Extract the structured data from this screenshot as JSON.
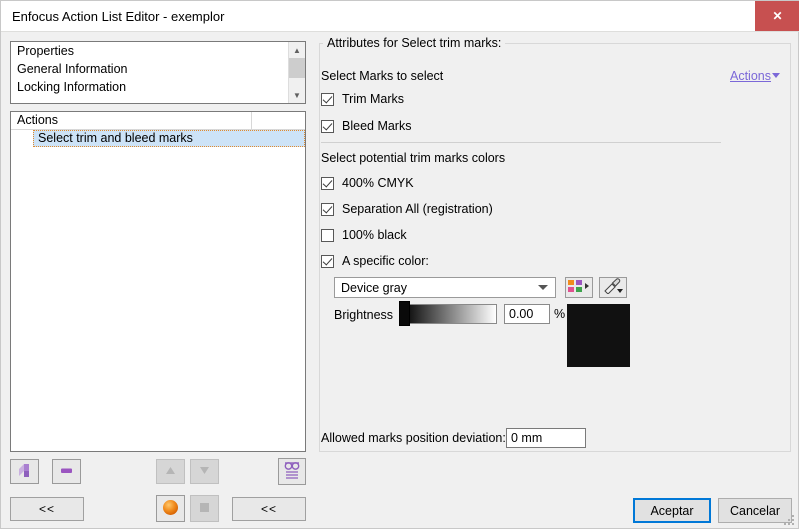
{
  "window": {
    "title": "Enfocus Action List Editor - exemplor",
    "close_label": "✕"
  },
  "properties_list": {
    "items": [
      {
        "label": "Properties"
      },
      {
        "label": "General Information"
      },
      {
        "label": "Locking Information"
      }
    ]
  },
  "actions_list": {
    "header": "Actions",
    "rows": [
      {
        "label": "Select trim and bleed marks",
        "selected": true
      }
    ]
  },
  "left_toolbar": {
    "add_action_icon": "add-action-icon",
    "remove_action_icon": "remove-action-icon",
    "move_up_icon": "move-up-icon",
    "move_down_icon": "move-down-icon",
    "preview_icon": "glasses-preview-icon",
    "collapse_left_label": "<<",
    "enabled_icon": "orange-sphere-icon",
    "disabled_icon": "gray-square-icon",
    "collapse_mid_label": "<<"
  },
  "attributes": {
    "group_title": "Attributes for Select trim marks:",
    "marks_section_label": "Select Marks to select",
    "actions_link": "Actions",
    "marks_checkboxes": [
      {
        "label": "Trim Marks",
        "checked": true
      },
      {
        "label": "Bleed Marks",
        "checked": true
      }
    ],
    "colors_section_label": "Select potential trim marks colors",
    "color_checkboxes": [
      {
        "label": "400% CMYK",
        "checked": true
      },
      {
        "label": "Separation All (registration)",
        "checked": true
      },
      {
        "label": "100% black",
        "checked": false
      },
      {
        "label": "A specific color:",
        "checked": true
      }
    ],
    "colorspace_combo": {
      "value": "Device gray"
    },
    "swatch_picker_icon": "color-swatches-icon",
    "eyedropper_icon": "eyedropper-icon",
    "brightness_label": "Brightness",
    "brightness_value": "0.00",
    "brightness_unit": "%",
    "swatch_color": "#111111",
    "deviation_label": "Allowed marks position deviation:",
    "deviation_value": "0 mm"
  },
  "dialog_buttons": {
    "accept": "Aceptar",
    "cancel": "Cancelar"
  },
  "colors": {
    "accent_link": "#7b68d8",
    "focus_border": "#0078d7",
    "selection_bg": "#cde3f7",
    "close_button": "#c75050"
  }
}
